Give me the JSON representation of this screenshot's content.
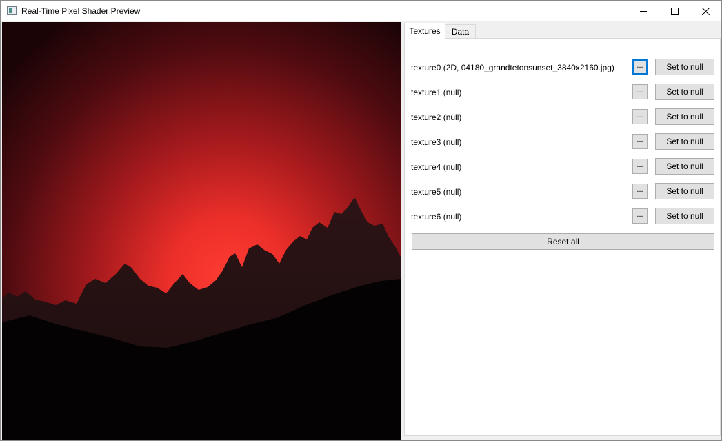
{
  "window": {
    "title": "Real-Time Pixel Shader Preview"
  },
  "tabs": [
    {
      "label": "Textures",
      "active": true
    },
    {
      "label": "Data",
      "active": false
    }
  ],
  "textures": [
    {
      "label": "texture0 (2D, 04180_grandtetonsunset_3840x2160.jpg)",
      "browse": "...",
      "clear": "Set to null"
    },
    {
      "label": "texture1 (null)",
      "browse": "...",
      "clear": "Set to null"
    },
    {
      "label": "texture2 (null)",
      "browse": "...",
      "clear": "Set to null"
    },
    {
      "label": "texture3 (null)",
      "browse": "...",
      "clear": "Set to null"
    },
    {
      "label": "texture4 (null)",
      "browse": "...",
      "clear": "Set to null"
    },
    {
      "label": "texture5 (null)",
      "browse": "...",
      "clear": "Set to null"
    },
    {
      "label": "texture6 (null)",
      "browse": "...",
      "clear": "Set to null"
    }
  ],
  "reset_label": "Reset all",
  "colors": {
    "focus": "#0078d7",
    "sky_glow": "#ff3b30",
    "sky_dark": "#1a0406"
  },
  "icons": {
    "app": "app-window-icon",
    "minimize": "minimize-icon",
    "maximize": "maximize-icon",
    "close": "close-icon"
  }
}
